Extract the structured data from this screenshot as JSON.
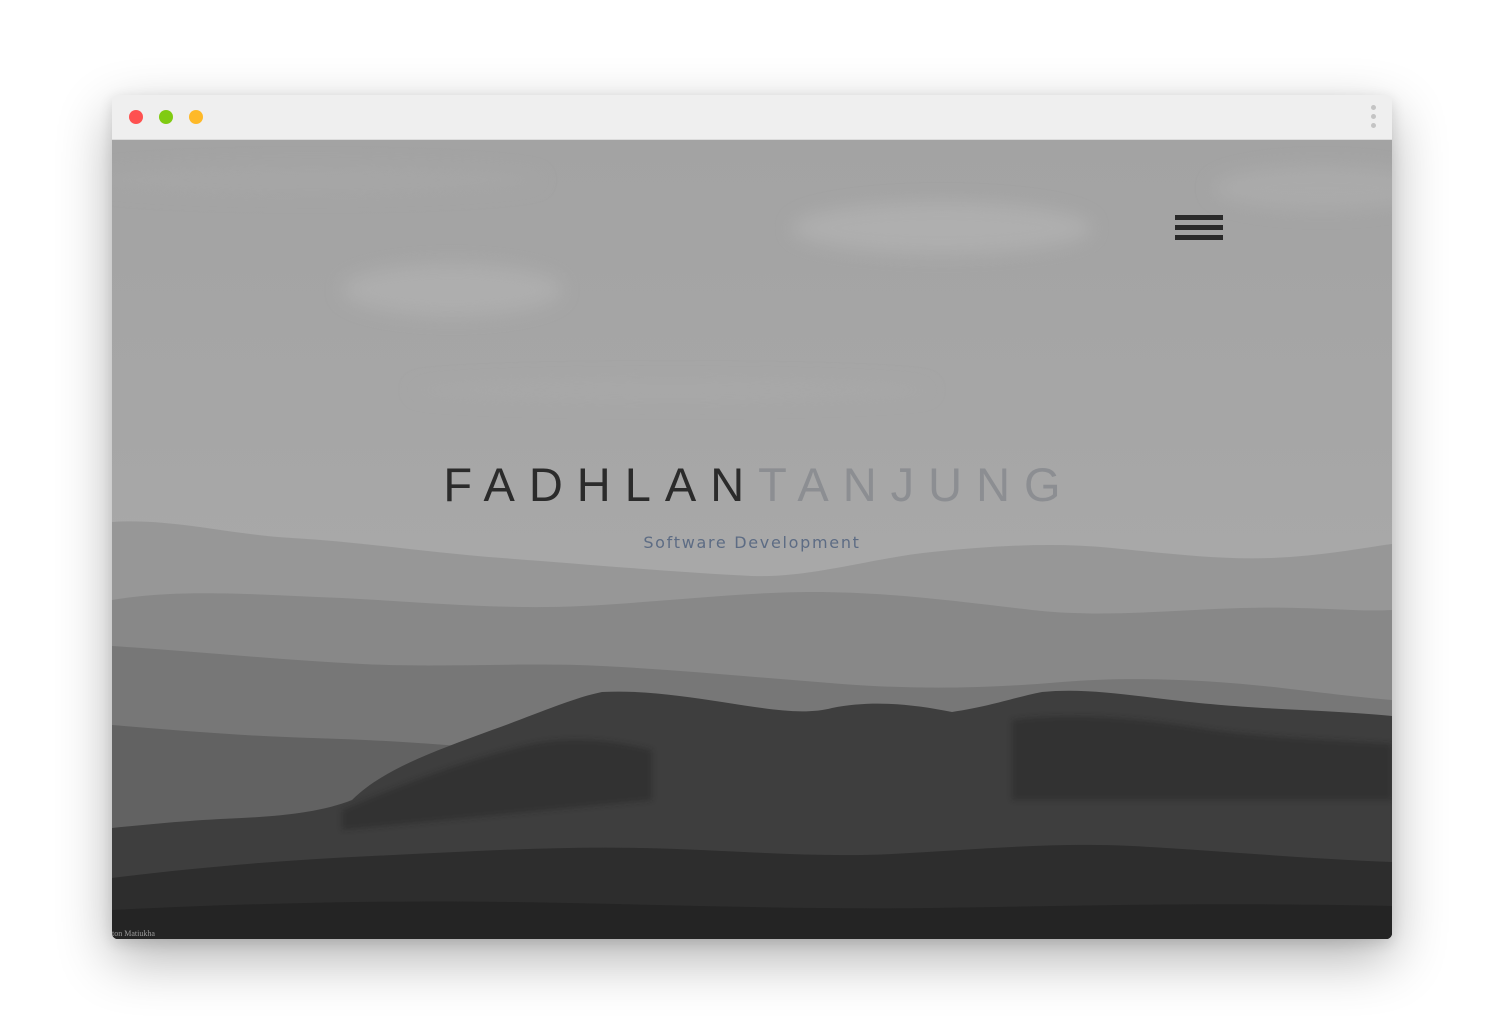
{
  "window": {
    "controls": [
      "close",
      "minimize",
      "maximize"
    ],
    "menu_icon": "kebab-menu-icon"
  },
  "hero": {
    "first_name": "FADHLAN",
    "last_name": "TANJUNG",
    "subtitle": "Software Development"
  },
  "nav": {
    "menu_icon": "hamburger-menu-icon"
  },
  "photo": {
    "credit": "ton Matiukha"
  },
  "colors": {
    "first_name": "#2b2b2b",
    "last_name": "#8c8e92",
    "subtitle": "#5d6c84",
    "close": "#fe5150",
    "minimize": "#80cb12",
    "maximize": "#feb928"
  }
}
